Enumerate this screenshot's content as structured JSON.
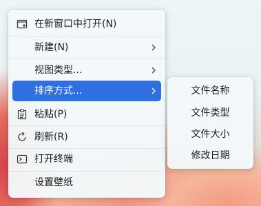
{
  "context_menu": {
    "items": [
      {
        "label": "在新窗口中打开(N)",
        "icon": "new-window-icon",
        "has_submenu": false
      },
      {
        "label": "新建(N)",
        "icon": null,
        "has_submenu": true
      },
      {
        "label": "视图类型...",
        "icon": null,
        "has_submenu": true
      },
      {
        "label": "排序方式...",
        "icon": null,
        "has_submenu": true,
        "active": true
      },
      {
        "label": "粘贴(P)",
        "icon": "clipboard-icon",
        "has_submenu": false
      },
      {
        "label": "刷新(R)",
        "icon": "refresh-icon",
        "has_submenu": false
      },
      {
        "label": "打开终端",
        "icon": "terminal-icon",
        "has_submenu": false
      },
      {
        "label": "设置壁纸",
        "icon": null,
        "has_submenu": false
      }
    ]
  },
  "sort_submenu": {
    "items": [
      {
        "label": "文件名称"
      },
      {
        "label": "文件类型"
      },
      {
        "label": "文件大小"
      },
      {
        "label": "修改日期"
      }
    ]
  },
  "colors": {
    "highlight": "#2f6fe0",
    "menu_bg": "#f3f9fb",
    "text": "#1a1a1a"
  }
}
